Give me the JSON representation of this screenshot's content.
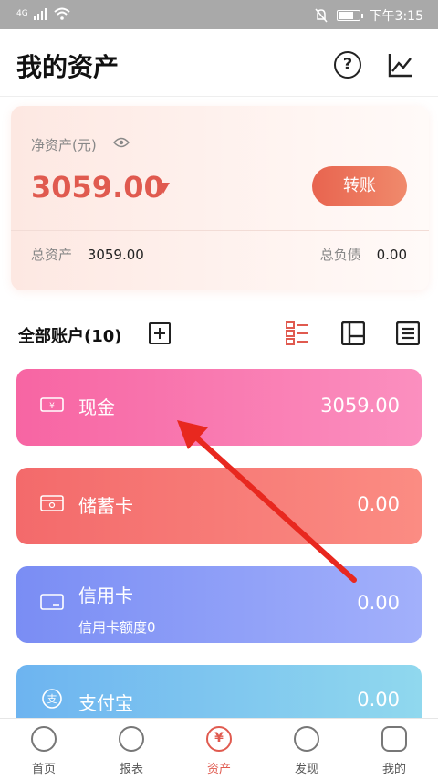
{
  "status_bar": {
    "signal_label": "4G",
    "time": "下午3:15"
  },
  "header": {
    "title": "我的资产"
  },
  "summary": {
    "net_label": "净资产(元)",
    "net_value": "3059.00",
    "transfer_label": "转账",
    "total_assets_label": "总资产",
    "total_assets_value": "3059.00",
    "total_liabilities_label": "总负债",
    "total_liabilities_value": "0.00"
  },
  "accounts_header": {
    "label": "全部账户(10)"
  },
  "accounts": [
    {
      "name": "现金",
      "amount": "3059.00",
      "sub": "",
      "icon": "cash-icon",
      "colors": [
        "#f765a3",
        "#fb8fbf"
      ]
    },
    {
      "name": "储蓄卡",
      "amount": "0.00",
      "sub": "",
      "icon": "debit-card-icon",
      "colors": [
        "#f36a6b",
        "#fb8c83"
      ]
    },
    {
      "name": "信用卡",
      "amount": "0.00",
      "sub": "信用卡额度0",
      "icon": "credit-card-icon",
      "colors": [
        "#7a8df4",
        "#a2b0fb"
      ]
    },
    {
      "name": "支付宝",
      "amount": "0.00",
      "sub": "",
      "icon": "alipay-icon",
      "colors": [
        "#6db4f0",
        "#90d8ee"
      ]
    }
  ],
  "tabs": [
    {
      "label": "首页",
      "icon": "home-icon"
    },
    {
      "label": "报表",
      "icon": "report-icon"
    },
    {
      "label": "资产",
      "icon": "yuan-icon"
    },
    {
      "label": "发现",
      "icon": "discover-icon"
    },
    {
      "label": "我的",
      "icon": "profile-icon"
    }
  ],
  "active_tab": "资产",
  "accent_color": "#e05a4f"
}
